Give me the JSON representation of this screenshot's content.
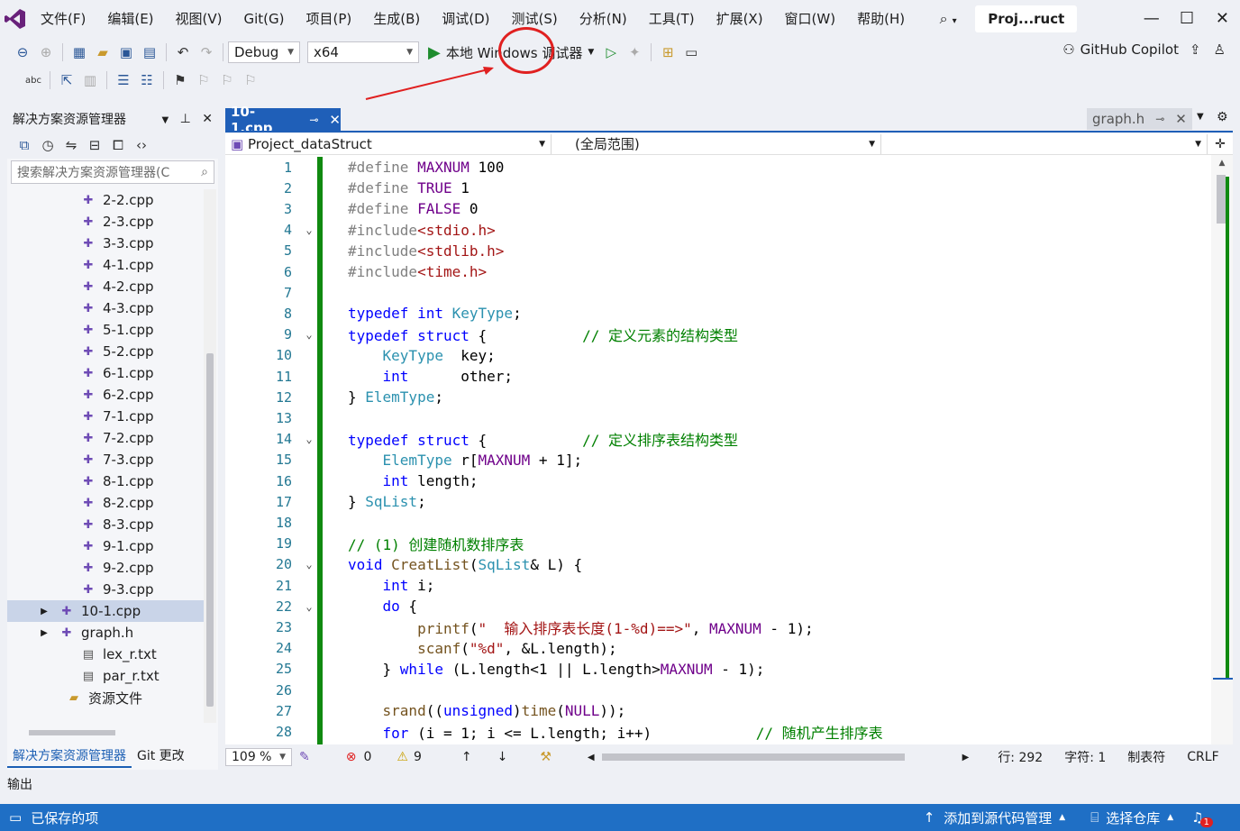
{
  "menu": {
    "items": [
      "文件(F)",
      "编辑(E)",
      "视图(V)",
      "Git(G)",
      "项目(P)",
      "生成(B)",
      "调试(D)",
      "测试(S)",
      "分析(N)",
      "工具(T)",
      "扩展(X)",
      "窗口(W)",
      "帮助(H)"
    ],
    "project_title": "Proj...ruct"
  },
  "toolbar": {
    "config": "Debug",
    "platform": "x64",
    "run_label": "本地 Windows 调试器",
    "copilot_label": "GitHub Copilot"
  },
  "solution_explorer": {
    "title": "解决方案资源管理器",
    "search_placeholder": "搜索解决方案资源管理器(C",
    "items": [
      {
        "label": "2-2.cpp",
        "type": "cpp"
      },
      {
        "label": "2-3.cpp",
        "type": "cpp"
      },
      {
        "label": "3-3.cpp",
        "type": "cpp"
      },
      {
        "label": "4-1.cpp",
        "type": "cpp"
      },
      {
        "label": "4-2.cpp",
        "type": "cpp"
      },
      {
        "label": "4-3.cpp",
        "type": "cpp"
      },
      {
        "label": "5-1.cpp",
        "type": "cpp"
      },
      {
        "label": "5-2.cpp",
        "type": "cpp"
      },
      {
        "label": "6-1.cpp",
        "type": "cpp"
      },
      {
        "label": "6-2.cpp",
        "type": "cpp"
      },
      {
        "label": "7-1.cpp",
        "type": "cpp"
      },
      {
        "label": "7-2.cpp",
        "type": "cpp"
      },
      {
        "label": "7-3.cpp",
        "type": "cpp"
      },
      {
        "label": "8-1.cpp",
        "type": "cpp"
      },
      {
        "label": "8-2.cpp",
        "type": "cpp"
      },
      {
        "label": "8-3.cpp",
        "type": "cpp"
      },
      {
        "label": "9-1.cpp",
        "type": "cpp"
      },
      {
        "label": "9-2.cpp",
        "type": "cpp"
      },
      {
        "label": "9-3.cpp",
        "type": "cpp"
      },
      {
        "label": "10-1.cpp",
        "type": "cpp",
        "selected": true,
        "expandable": true
      },
      {
        "label": "graph.h",
        "type": "h",
        "expandable": true
      },
      {
        "label": "lex_r.txt",
        "type": "txt"
      },
      {
        "label": "par_r.txt",
        "type": "txt"
      },
      {
        "label": "资源文件",
        "type": "folder"
      }
    ],
    "tabs": [
      "解决方案资源管理器",
      "Git 更改"
    ]
  },
  "editor": {
    "active_tab": "10-1.cpp",
    "other_tab": "graph.h",
    "nav_project": "Project_dataStruct",
    "nav_scope": "(全局范围)",
    "zoom": "109 %",
    "errors": "0",
    "warnings": "9",
    "line_info": "行: 292",
    "char_info": "字符: 1",
    "tab_info": "制表符",
    "eol": "CRLF",
    "lines": [
      {
        "n": "1",
        "html": "<span class='pp'>#define</span> <span class='mac'>MAXNUM</span> 100"
      },
      {
        "n": "2",
        "html": "<span class='pp'>#define</span> <span class='mac'>TRUE</span> 1"
      },
      {
        "n": "3",
        "html": "<span class='pp'>#define</span> <span class='mac'>FALSE</span> 0"
      },
      {
        "n": "4",
        "fold": true,
        "html": "<span class='pp'>#include</span><span class='str'>&lt;stdio.h&gt;</span>"
      },
      {
        "n": "5",
        "html": "<span class='pp'>#include</span><span class='str'>&lt;stdlib.h&gt;</span>"
      },
      {
        "n": "6",
        "html": "<span class='pp'>#include</span><span class='str'>&lt;time.h&gt;</span>"
      },
      {
        "n": "7",
        "html": ""
      },
      {
        "n": "8",
        "html": "<span class='kw'>typedef</span> <span class='kw'>int</span> <span class='ty'>KeyType</span>;"
      },
      {
        "n": "9",
        "fold": true,
        "html": "<span class='kw'>typedef</span> <span class='kw'>struct</span> {           <span class='cm'>// 定义元素的结构类型</span>"
      },
      {
        "n": "10",
        "html": "    <span class='ty'>KeyType</span>  key;"
      },
      {
        "n": "11",
        "html": "    <span class='kw'>int</span>      other;"
      },
      {
        "n": "12",
        "html": "} <span class='ty'>ElemType</span>;"
      },
      {
        "n": "13",
        "html": ""
      },
      {
        "n": "14",
        "fold": true,
        "html": "<span class='kw'>typedef</span> <span class='kw'>struct</span> {           <span class='cm'>// 定义排序表结构类型</span>"
      },
      {
        "n": "15",
        "html": "    <span class='ty'>ElemType</span> r[<span class='mac'>MAXNUM</span> + 1];"
      },
      {
        "n": "16",
        "html": "    <span class='kw'>int</span> length;"
      },
      {
        "n": "17",
        "html": "} <span class='ty'>SqList</span>;"
      },
      {
        "n": "18",
        "html": ""
      },
      {
        "n": "19",
        "html": "<span class='cm'>// (1) 创建随机数排序表</span>"
      },
      {
        "n": "20",
        "fold": true,
        "html": "<span class='kw'>void</span> <span class='fn'>CreatList</span>(<span class='ty'>SqList</span>&amp; L) {"
      },
      {
        "n": "21",
        "html": "    <span class='kw'>int</span> i;"
      },
      {
        "n": "22",
        "fold": true,
        "html": "    <span class='kw'>do</span> {"
      },
      {
        "n": "23",
        "html": "        <span class='fn'>printf</span>(<span class='str'>\"  输入排序表长度(1-%d)==&gt;\"</span>, <span class='mac'>MAXNUM</span> - 1);"
      },
      {
        "n": "24",
        "html": "        <span class='fn'>scanf</span>(<span class='str'>\"%d\"</span>, &amp;L.length);"
      },
      {
        "n": "25",
        "html": "    } <span class='kw'>while</span> (L.length&lt;1 || L.length&gt;<span class='mac'>MAXNUM</span> - 1);"
      },
      {
        "n": "26",
        "html": ""
      },
      {
        "n": "27",
        "html": "    <span class='fn'>srand</span>((<span class='kw'>unsigned</span>)<span class='fn'>time</span>(<span class='mac'>NULL</span>));"
      },
      {
        "n": "28",
        "html": "    <span class='kw'>for</span> (i = 1; i &lt;= L.length; i++)            <span class='cm'>// 随机产生排序表</span>"
      }
    ]
  },
  "output_panel": {
    "title": "输出"
  },
  "statusbar": {
    "saved": "已保存的项",
    "source_control": "添加到源代码管理",
    "repo": "选择仓库",
    "notifications": "1"
  },
  "colors": {
    "accent": "#1f5fb8",
    "statusbar": "#1f6fc5",
    "change_bar": "#108a10",
    "annotation": "#e02020"
  }
}
